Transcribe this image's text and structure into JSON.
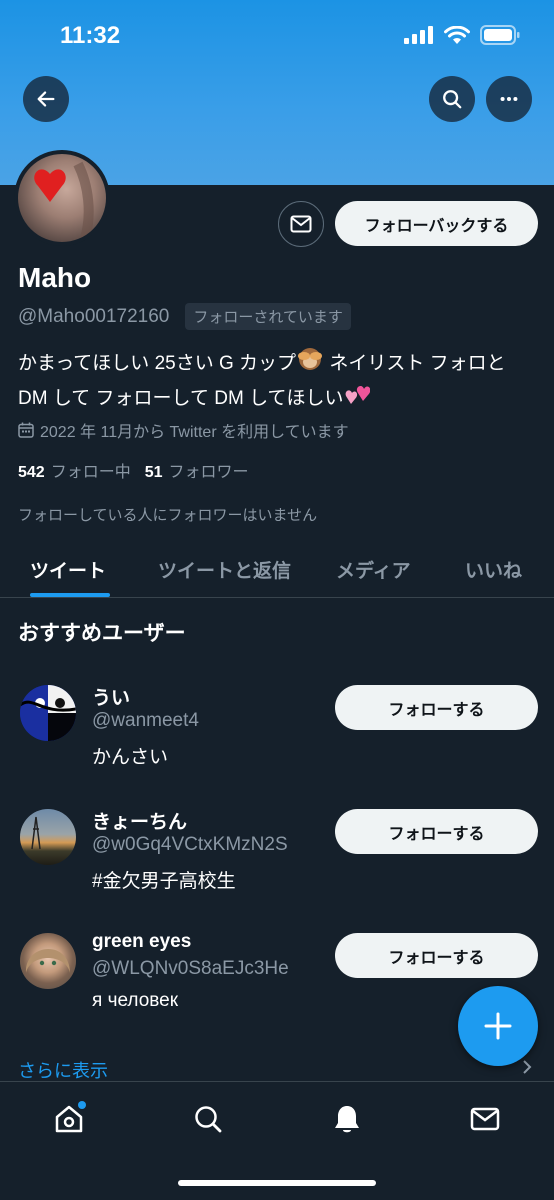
{
  "status": {
    "time": "11:32"
  },
  "profile": {
    "name": "Maho",
    "handle": "@Maho00172160",
    "follows_you": "フォローされています",
    "follow_back_label": "フォローバックする",
    "bio_line1_a": "かまってほしい 25さい G カップ",
    "bio_line1_b": " ネイリスト フォロと",
    "bio_line2": "DM して フォローして DM してほしい",
    "joined": "2022 年 11月から Twitter を利用しています",
    "following_count": "542",
    "following_label": "フォロー中",
    "followers_count": "51",
    "followers_label": "フォロワー",
    "mutuals_text": "フォローしている人にフォロワーはいません"
  },
  "tabs": [
    {
      "label": "ツイート"
    },
    {
      "label": "ツイートと返信"
    },
    {
      "label": "メディア"
    },
    {
      "label": "いいね"
    }
  ],
  "suggested": {
    "title": "おすすめユーザー",
    "follow_label": "フォローする",
    "users": [
      {
        "name": "うい",
        "handle": "@wanmeet4",
        "bio": "かんさい"
      },
      {
        "name": "きょーちん",
        "handle": "@w0Gq4VCtxKMzN2S",
        "bio": "#金欠男子高校生"
      },
      {
        "name": "green eyes",
        "handle": "@WLQNv0S8aEJc3He",
        "bio": "я человек"
      }
    ],
    "show_more": "さらに表示"
  },
  "icons": {
    "back": "arrow-left-icon",
    "search": "search-icon",
    "more": "more-horizontal-icon",
    "mail": "mail-icon",
    "calendar": "calendar-icon",
    "compose": "plus-icon",
    "nav": [
      "home-icon",
      "search-icon",
      "bell-icon",
      "mail-icon"
    ]
  },
  "colors": {
    "background": "#15202b",
    "accent": "#1d9bf0",
    "banner": "#3a9ee8",
    "muted_text": "#8b98a5"
  }
}
